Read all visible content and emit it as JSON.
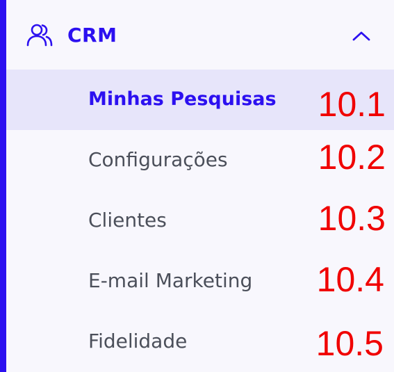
{
  "sidebar": {
    "section": {
      "icon": "users-icon",
      "label": "CRM",
      "toggle_icon": "chevron-up-icon",
      "expanded": true
    },
    "items": [
      {
        "label": "Minhas Pesquisas",
        "active": true,
        "annotation": "10.1"
      },
      {
        "label": "Configurações",
        "active": false,
        "annotation": "10.2"
      },
      {
        "label": "Clientes",
        "active": false,
        "annotation": "10.3"
      },
      {
        "label": "E-mail Marketing",
        "active": false,
        "annotation": "10.4"
      },
      {
        "label": "Fidelidade",
        "active": false,
        "annotation": "10.5"
      }
    ]
  },
  "colors": {
    "accent": "#2c10f0",
    "active_bg": "#e7e5fa",
    "sidebar_bg": "#f8f7fd",
    "item_text": "#4b4f5a",
    "annotation": "#f00000"
  }
}
